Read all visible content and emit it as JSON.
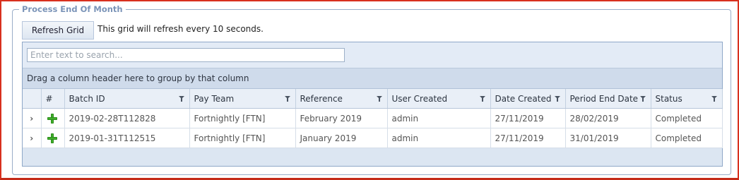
{
  "panel": {
    "title": "Process End Of Month",
    "refresh_label": "Refresh Grid",
    "refresh_note": "This grid will refresh every 10 seconds."
  },
  "search": {
    "placeholder": "Enter text to search...",
    "value": ""
  },
  "group_panel": {
    "text": "Drag a column header here to group by that column"
  },
  "columns": {
    "index": "#",
    "batch_id": "Batch ID",
    "pay_team": "Pay Team",
    "reference": "Reference",
    "user_created": "User Created",
    "date_created": "Date Created",
    "period_end_date": "Period End Date",
    "status": "Status"
  },
  "rows": [
    {
      "expand": "›",
      "batch_id": "2019-02-28T112828",
      "pay_team": "Fortnightly [FTN]",
      "reference": "February 2019",
      "user_created": "admin",
      "date_created": "27/11/2019",
      "period_end_date": "28/02/2019",
      "status": "Completed"
    },
    {
      "expand": "›",
      "batch_id": "2019-01-31T112515",
      "pay_team": "Fortnightly [FTN]",
      "reference": "January 2019",
      "user_created": "admin",
      "date_created": "27/11/2019",
      "period_end_date": "31/01/2019",
      "status": "Completed"
    }
  ],
  "icons": {
    "row_action": "green-plus-icon",
    "filter": "filter-icon",
    "expand": "chevron-right-icon"
  },
  "colors": {
    "border_accent": "#d8301e",
    "legend": "#7b94b8",
    "plus": "#3fae2a"
  }
}
